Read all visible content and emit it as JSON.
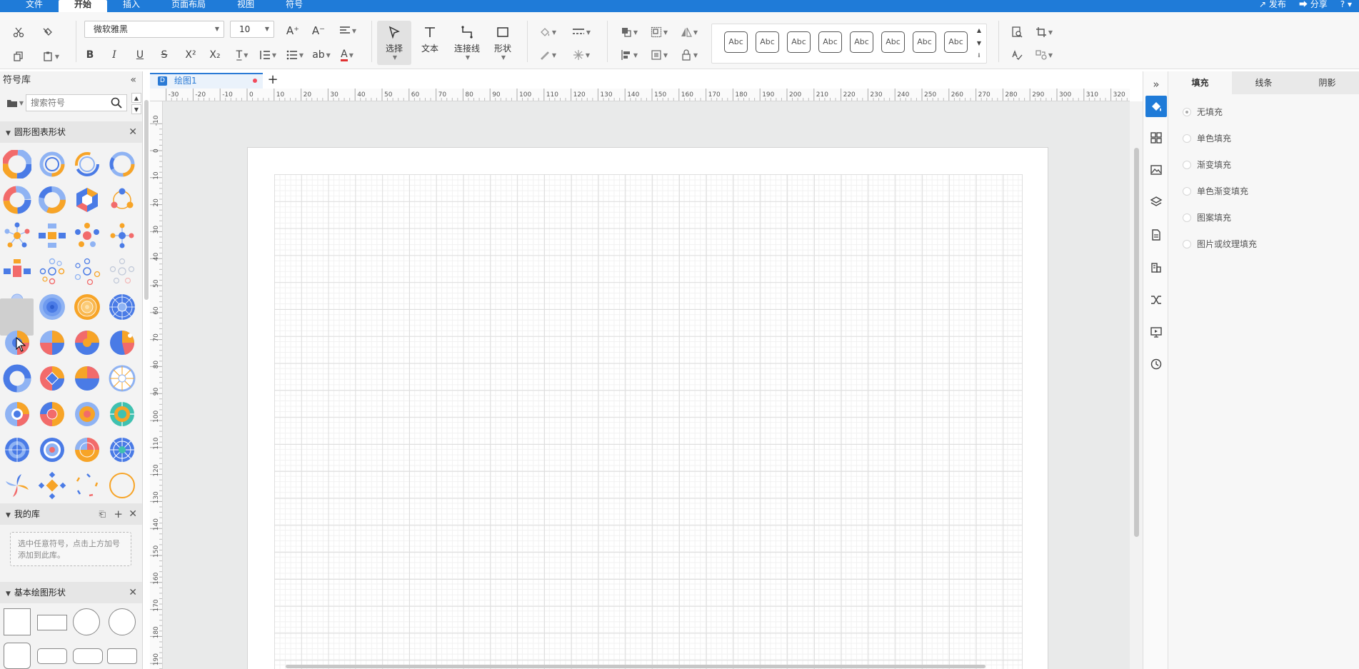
{
  "menubar": {
    "tabs": [
      "文件",
      "开始",
      "插入",
      "页面布局",
      "视图",
      "符号"
    ],
    "right": [
      "发布",
      "分享",
      "?"
    ]
  },
  "ribbon": {
    "font_name": "微软雅黑",
    "font_size": "10",
    "tools": {
      "select": "选择",
      "text": "文本",
      "connector": "连接线",
      "shape": "形状"
    },
    "style_preview": "Abc"
  },
  "left_panel": {
    "title": "符号库",
    "search_placeholder": "搜索符号",
    "sections": {
      "chart_shapes": "圆形图表形状",
      "my_library": "我的库",
      "basic_shapes": "基本绘图形状"
    },
    "my_library_hint": "选中任意符号，点击上方加号添加到此库。"
  },
  "doc_tab": {
    "name": "绘图1"
  },
  "right_panel": {
    "tabs": [
      "填充",
      "线条",
      "阴影"
    ],
    "fill_options": [
      "无填充",
      "单色填充",
      "渐变填充",
      "单色渐变填充",
      "图案填充",
      "图片或纹理填充"
    ],
    "selected_fill": 0
  },
  "colors": {
    "brand_blue": "#1f7bd8",
    "chart_blue": "#4a7be6",
    "chart_orange": "#f7a427",
    "chart_red": "#f26b6b",
    "chart_light_blue": "#8fb3f3"
  }
}
